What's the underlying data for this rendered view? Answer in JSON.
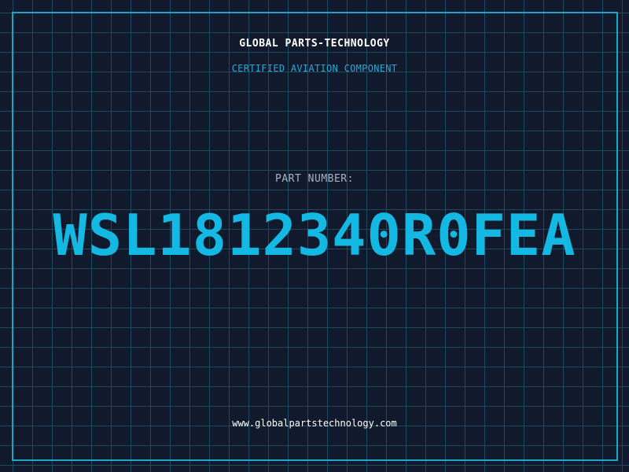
{
  "header": {
    "company": "GLOBAL PARTS-TECHNOLOGY",
    "subtitle": "CERTIFIED AVIATION COMPONENT"
  },
  "part": {
    "label": "PART NUMBER:",
    "number": "WSL1812340R0FEA"
  },
  "footer": {
    "website": "www.globalpartstechnology.com"
  },
  "colors": {
    "background": "#111a2c",
    "grid": "#1d4a5e",
    "frame": "#1aa6c9",
    "accent": "#13b8e3"
  }
}
